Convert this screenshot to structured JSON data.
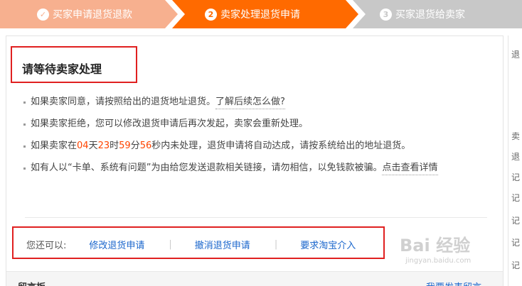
{
  "steps": [
    {
      "icon": "✓",
      "label": "买家申请退货退款"
    },
    {
      "icon": "2",
      "label": "卖家处理退货申请"
    },
    {
      "icon": "3",
      "label": "买家退货给卖家"
    }
  ],
  "title": "请等待卖家处理",
  "info": {
    "line1_text": "如果卖家同意，请按照给出的退货地址退货。",
    "line1_link": "了解后续怎么做?",
    "line2_text": "如果卖家拒绝，您可以修改退货申请后再次发起，卖家会重新处理。",
    "line3_prefix": "如果卖家在",
    "countdown": {
      "days": "04",
      "days_unit": "天",
      "hours": "23",
      "hours_unit": "时",
      "minutes": "59",
      "minutes_unit": "分",
      "seconds": "56",
      "seconds_unit": "秒"
    },
    "line3_suffix": "内未处理，退货申请将自动达成，请按系统给出的地址退货。",
    "line4_text": "如有人以“卡单、系统有问题”为由给您发送退款相关链接，请勿相信，以免钱款被骗。",
    "line4_link": "点击查看详情"
  },
  "actions": {
    "lead": "您还可以:",
    "items": [
      "修改退货申请",
      "撤消退货申请",
      "要求淘宝介入"
    ],
    "separator": "|"
  },
  "footer": {
    "left": "留言板",
    "right": "我要发表留言"
  },
  "sidebar_chars": [
    "退",
    "卖",
    "退",
    "记",
    "记",
    "记",
    "记",
    "记"
  ],
  "watermark": {
    "main": "Bai 经验",
    "sub": "jingyan.baidu.com"
  },
  "colors": {
    "active_step": "#ff6a00",
    "done_step": "#f7b08f",
    "todo_step": "#c8c8c8",
    "highlight_border": "#e02020",
    "link": "#1a66cc",
    "countdown": "#ff4400"
  }
}
